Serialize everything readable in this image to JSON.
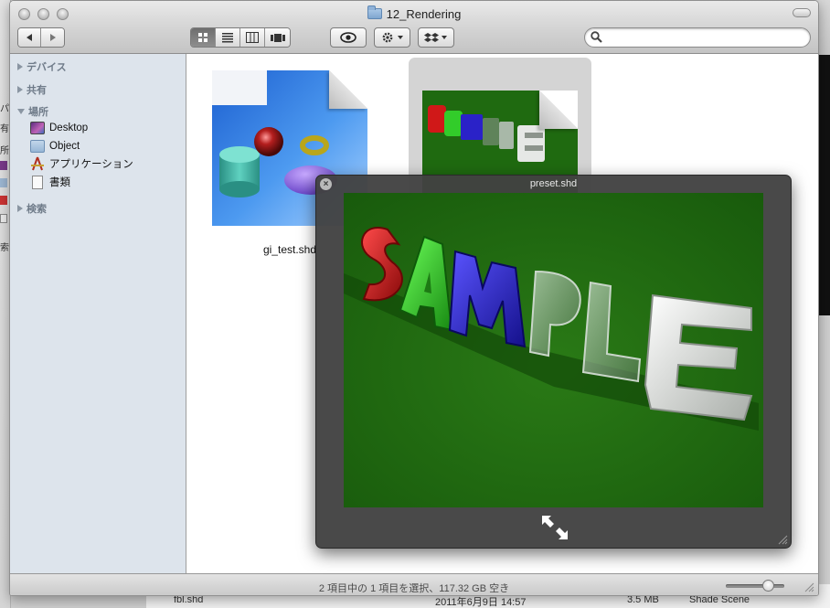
{
  "window": {
    "title": "12_Rendering"
  },
  "toolbar": {
    "back_icon": "back-arrow-icon",
    "forward_icon": "forward-arrow-icon",
    "view_modes": [
      "icon-view",
      "list-view",
      "column-view",
      "coverflow-view"
    ],
    "selected_view": "icon-view",
    "quicklook_icon": "eye-icon",
    "action_icon": "gear-icon",
    "dropbox_icon": "dropbox-icon",
    "search": {
      "value": "",
      "placeholder": ""
    }
  },
  "sidebar": {
    "sections": [
      {
        "label": "デバイス",
        "expanded": false
      },
      {
        "label": "共有",
        "expanded": false
      },
      {
        "label": "場所",
        "expanded": true
      },
      {
        "label": "検索",
        "expanded": false
      }
    ],
    "places": [
      {
        "label": "Desktop",
        "icon": "desktop-icon"
      },
      {
        "label": "Object",
        "icon": "folder-icon"
      },
      {
        "label": "アプリケーション",
        "icon": "applications-icon"
      },
      {
        "label": "書類",
        "icon": "document-icon"
      }
    ]
  },
  "files": [
    {
      "name": "gi_test.shd",
      "selected": false
    },
    {
      "name": "preset.shd",
      "selected": true
    }
  ],
  "quicklook": {
    "title": "preset.shd",
    "image_text": "SAMPLE"
  },
  "statusbar": {
    "text": "2 項目中の 1 項目を選択、117.32 GB 空き"
  },
  "background": {
    "left_fragments": [
      "パ",
      "有",
      "所",
      "索"
    ],
    "row_name": "fbl.shd",
    "row_date": "2011年6月9日 14:57",
    "row_size": "3.5 MB",
    "row_kind": "Shade Scene"
  },
  "colors": {
    "sidebar_bg": "#dde4ec",
    "quicklook_bg": "#424242",
    "render_green": "#1f6a10",
    "sample_red": "#d01818",
    "sample_green": "#32cc2a",
    "sample_blue": "#2a22c8"
  }
}
